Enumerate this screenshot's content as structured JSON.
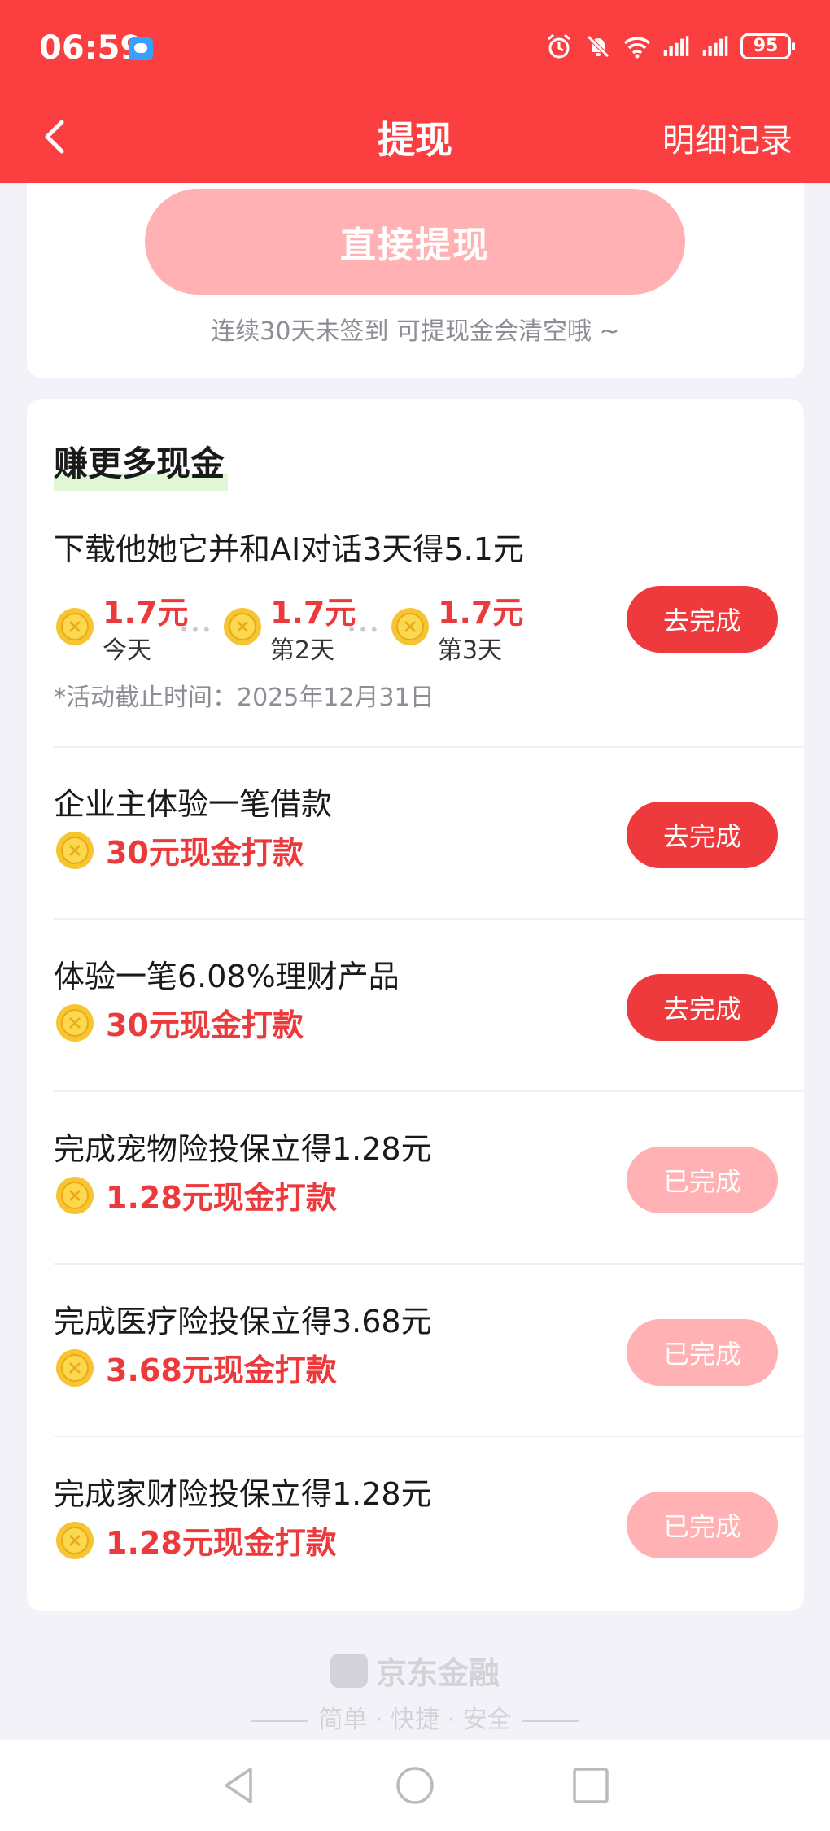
{
  "status_bar": {
    "time": "06:59",
    "battery": "95"
  },
  "nav": {
    "title": "提现",
    "detail_link": "明细记录"
  },
  "withdraw": {
    "button_label": "直接提现",
    "note": "连续30天未签到 可提现金会清空哦 ~"
  },
  "earn_section": {
    "title": "赚更多现金",
    "featured_task": {
      "title": "下载他她它并和AI对话3天得5.1元",
      "days": [
        {
          "amount": "1.7元",
          "label": "今天"
        },
        {
          "amount": "1.7元",
          "label": "第2天"
        },
        {
          "amount": "1.7元",
          "label": "第3天"
        }
      ],
      "deadline": "*活动截止时间：2025年12月31日",
      "button": "去完成"
    },
    "tasks": [
      {
        "title": "企业主体验一笔借款",
        "reward": "30元现金打款",
        "button": "去完成",
        "state": "active"
      },
      {
        "title": "体验一笔6.08%理财产品",
        "reward": "30元现金打款",
        "button": "去完成",
        "state": "active"
      },
      {
        "title": "完成宠物险投保立得1.28元",
        "reward": "1.28元现金打款",
        "button": "已完成",
        "state": "done"
      },
      {
        "title": "完成医疗险投保立得3.68元",
        "reward": "3.68元现金打款",
        "button": "已完成",
        "state": "done"
      },
      {
        "title": "完成家财险投保立得1.28元",
        "reward": "1.28元现金打款",
        "button": "已完成",
        "state": "done"
      }
    ]
  },
  "footer": {
    "brand": "京东金融",
    "slogan": "简单 · 快捷 · 安全"
  },
  "colors": {
    "header": "#fb3f41",
    "accent_red": "#ee3a3c",
    "disabled_pink": "#ffb1b3",
    "reward_text": "#ec3a3c"
  }
}
